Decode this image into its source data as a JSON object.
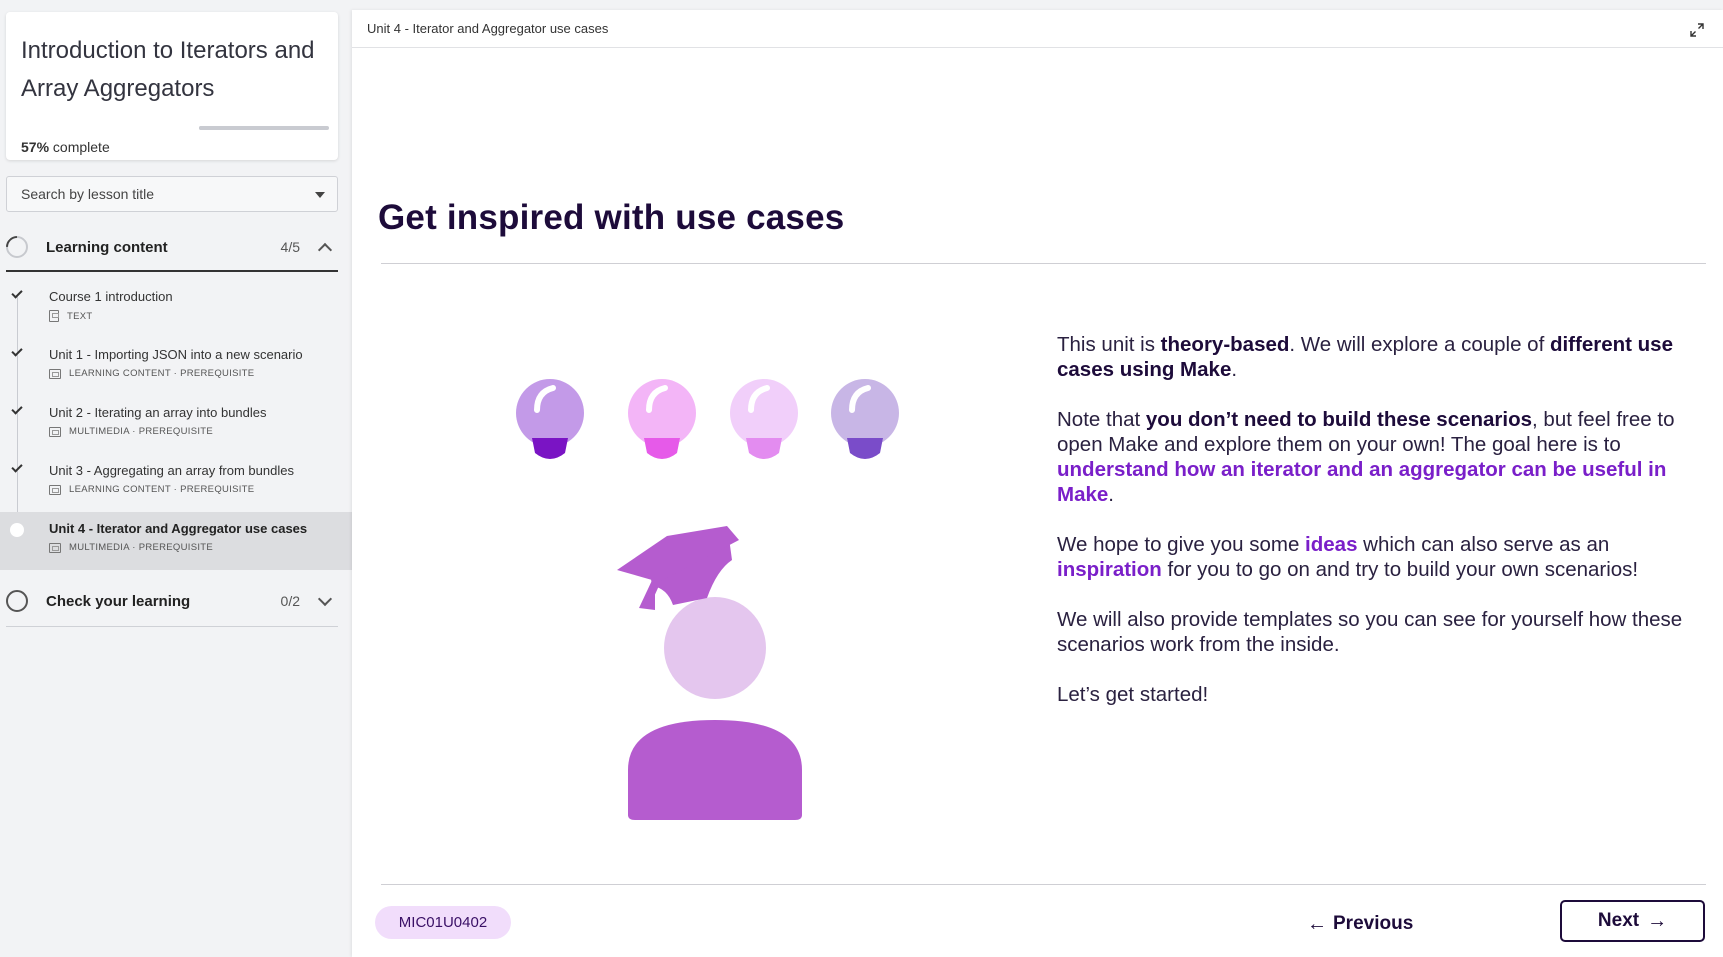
{
  "course": {
    "title": "Introduction to Iterators and Array Aggregators",
    "progress_fraction": 0.57,
    "progress_pct": "57%",
    "progress_suffix": " complete"
  },
  "search": {
    "placeholder": "Search by lesson title"
  },
  "sections": [
    {
      "label": "Learning content",
      "count": "4/5",
      "expanded": true
    },
    {
      "label": "Check your learning",
      "count": "0/2",
      "expanded": false
    }
  ],
  "lessons": [
    {
      "title": "Course 1 introduction",
      "meta": "TEXT",
      "completed": true
    },
    {
      "title": "Unit 1 - Importing JSON into a new scenario",
      "meta": "LEARNING CONTENT · PREREQUISITE",
      "completed": true
    },
    {
      "title": "Unit 2 - Iterating an array into bundles",
      "meta": "MULTIMEDIA · PREREQUISITE",
      "completed": true
    },
    {
      "title": "Unit 3 - Aggregating an array from bundles",
      "meta": "LEARNING CONTENT · PREREQUISITE",
      "completed": true
    },
    {
      "title": "Unit 4 - Iterator and Aggregator use cases",
      "meta": "MULTIMEDIA · PREREQUISITE",
      "completed": false,
      "active": true
    }
  ],
  "main": {
    "breadcrumb": "Unit 4 - Iterator and Aggregator use cases",
    "title": "Get inspired with use cases",
    "para1": {
      "a": "This unit is ",
      "b": "theory-based",
      "c": ". We will explore a couple of ",
      "d": "different use cases using Make",
      "e": "."
    },
    "para2": {
      "a": "Note that ",
      "b": "you don’t need to build these scenarios",
      "c": ", but feel free to open Make and explore them on your own! The goal here is to ",
      "d": "understand how an iterator and an aggregator can be useful in Make",
      "e": "."
    },
    "para3": {
      "a": "We hope to give you some ",
      "b": "ideas",
      "c": " which can also serve as an ",
      "d": "inspiration",
      "e": " for you to go on and try to build your own scenarios!"
    },
    "para4": "We will also provide templates so you can see for yourself how these scenarios work from the inside.",
    "para5": "Let’s get started!",
    "code": "MIC01U0402",
    "prev_label": "Previous",
    "next_label": "Next"
  },
  "icons": {
    "lesson_check": "check-icon",
    "expand": "expand-icon",
    "arrow_left": "←",
    "arrow_right": "→"
  },
  "colors": {
    "accent": "#7a1fc9",
    "title": "#1d0b3a",
    "badge_bg": "#f1ddfb",
    "bulb1": "#c39ae8",
    "bulb2": "#f3b5f7",
    "bulb3": "#f1cffa",
    "bulb4": "#c8b6e6",
    "person": "#b55ccf"
  }
}
